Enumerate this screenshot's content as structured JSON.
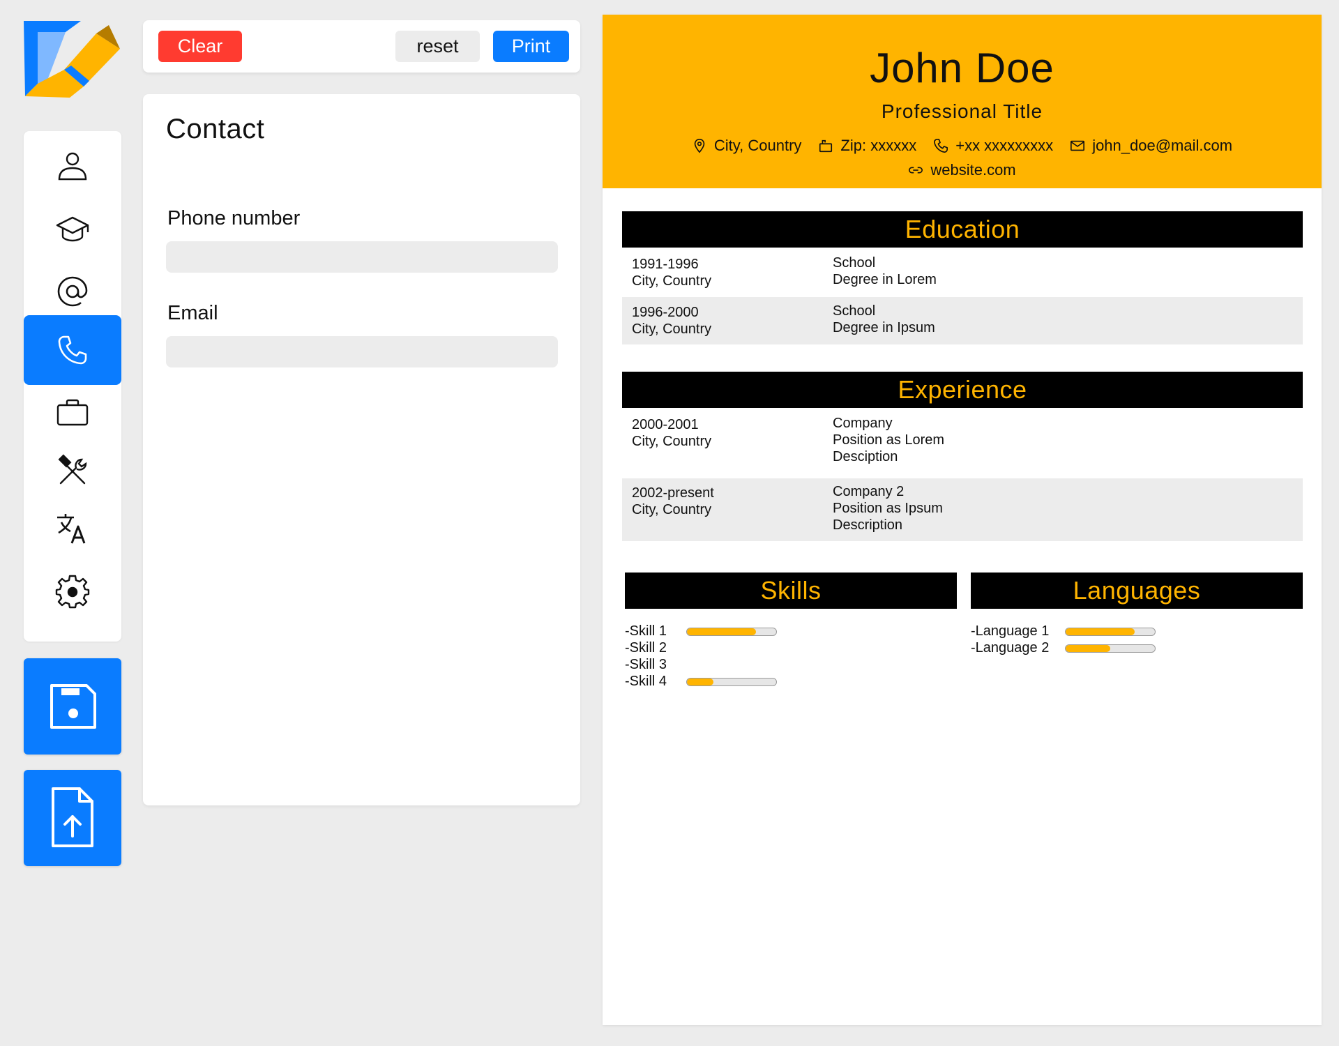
{
  "colors": {
    "accent_blue": "#0a7cff",
    "danger_red": "#ff3b30",
    "resume_accent": "#ffb400",
    "header_black": "#000000",
    "app_bg": "#ececec"
  },
  "toolbar": {
    "clear_label": "Clear",
    "reset_label": "reset",
    "print_label": "Print"
  },
  "sidebar": {
    "items": [
      {
        "name": "personal",
        "icon": "person-icon",
        "active": false
      },
      {
        "name": "education",
        "icon": "graduation-cap-icon",
        "active": false
      },
      {
        "name": "contact-email",
        "icon": "at-sign-icon",
        "active": false
      },
      {
        "name": "contact",
        "icon": "phone-icon",
        "active": true
      },
      {
        "name": "experience",
        "icon": "briefcase-icon",
        "active": false
      },
      {
        "name": "skills",
        "icon": "tools-icon",
        "active": false
      },
      {
        "name": "languages",
        "icon": "translate-icon",
        "active": false
      },
      {
        "name": "settings",
        "icon": "gear-icon",
        "active": false
      }
    ],
    "save_icon": "save-icon",
    "upload_icon": "file-upload-icon"
  },
  "form": {
    "title": "Contact",
    "phone_label": "Phone number",
    "phone_value": "",
    "email_label": "Email",
    "email_value": ""
  },
  "resume": {
    "name": "John Doe",
    "title": "Professional Title",
    "contact": {
      "location": "City, Country",
      "zip": "Zip: xxxxxx",
      "phone": "+xx xxxxxxxxx",
      "email": "john_doe@mail.com",
      "website": "website.com"
    },
    "education_header": "Education",
    "education": [
      {
        "years": "1991-1996",
        "place": "City, Country",
        "school": "School",
        "degree": "Degree in Lorem"
      },
      {
        "years": "1996-2000",
        "place": "City, Country",
        "school": "School",
        "degree": "Degree in Ipsum"
      }
    ],
    "experience_header": "Experience",
    "experience": [
      {
        "years": "2000-2001",
        "place": "City, Country",
        "company": "Company",
        "position": "Position as Lorem",
        "description": "Desciption"
      },
      {
        "years": "2002-present",
        "place": "City, Country",
        "company": "Company 2",
        "position": "Position as Ipsum",
        "description": "Description"
      }
    ],
    "skills_header": "Skills",
    "skills": [
      {
        "label": "-Skill 1",
        "level": 0.77
      },
      {
        "label": "-Skill 2",
        "level": null
      },
      {
        "label": "-Skill 3",
        "level": null
      },
      {
        "label": "-Skill 4",
        "level": 0.3
      }
    ],
    "languages_header": "Languages",
    "languages": [
      {
        "label": "-Language 1",
        "level": 0.77
      },
      {
        "label": "-Language 2",
        "level": 0.5
      }
    ]
  }
}
